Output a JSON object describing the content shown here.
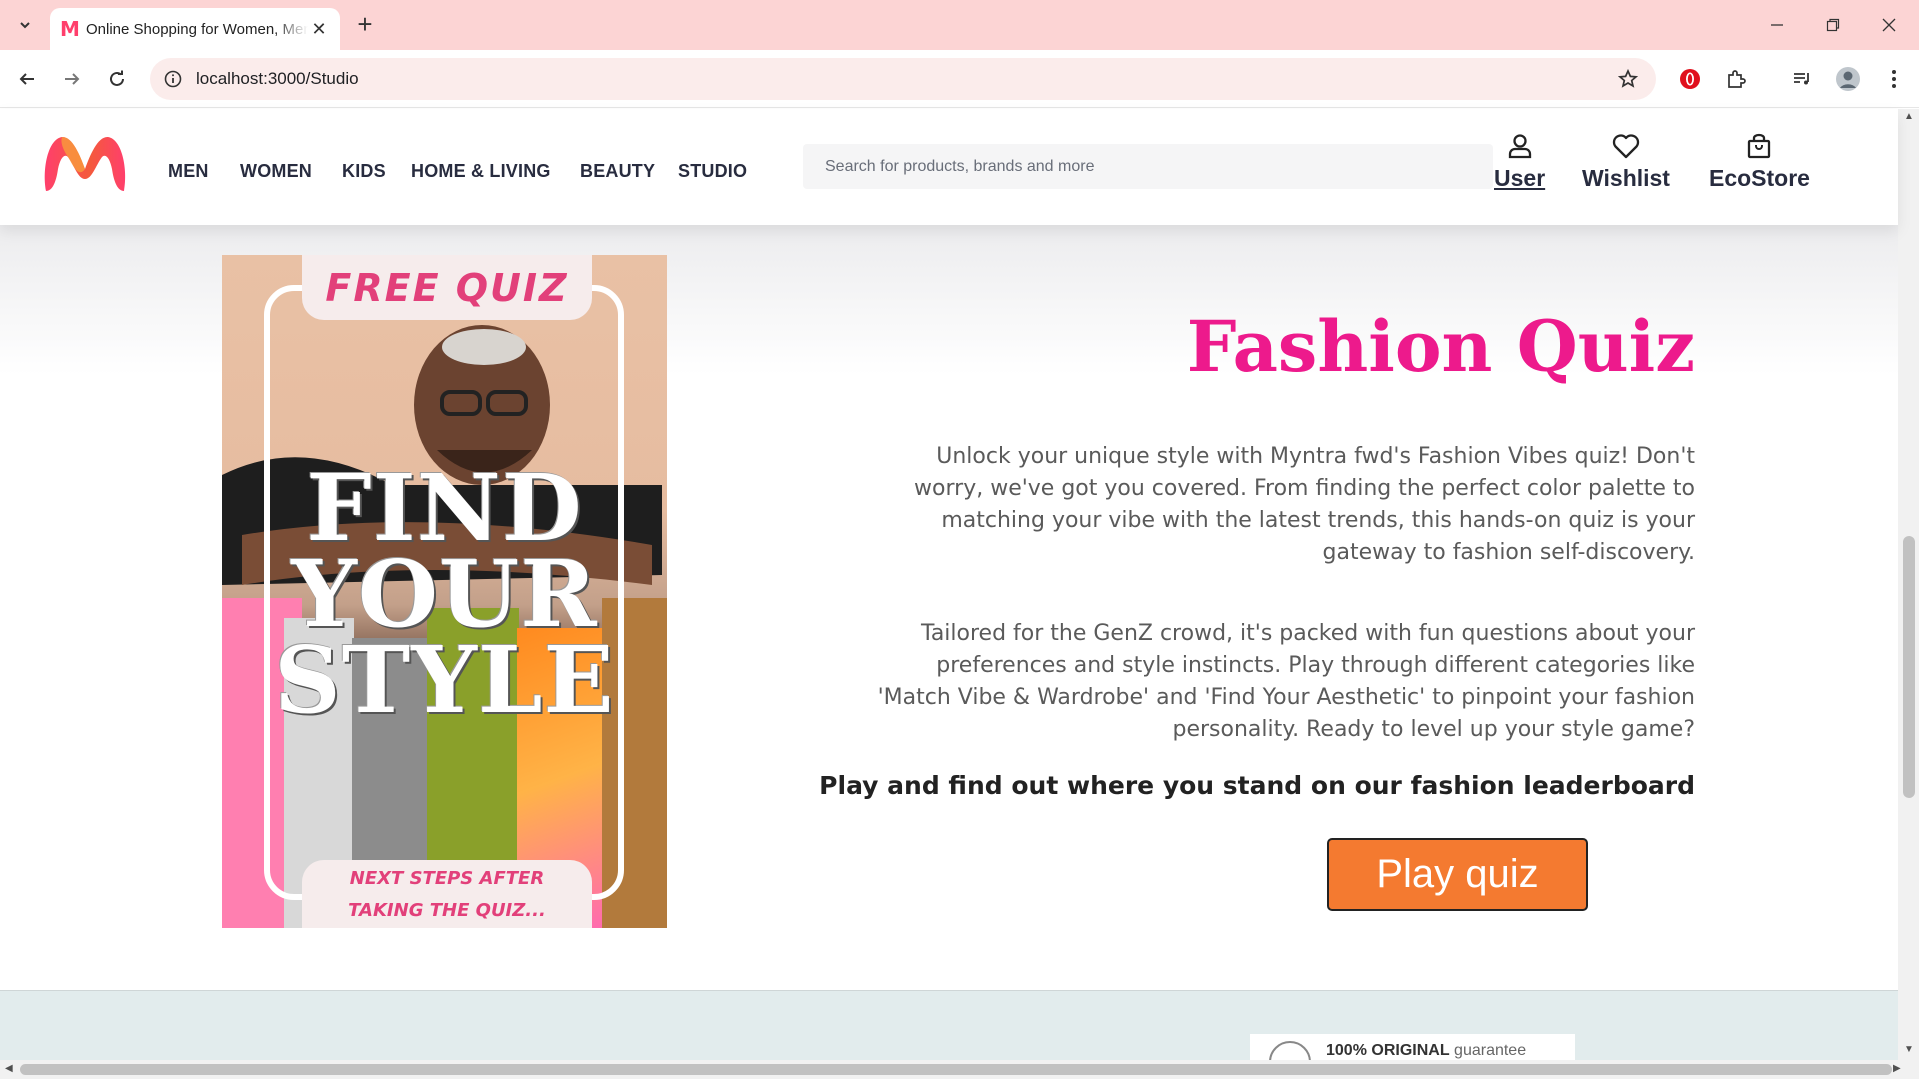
{
  "browser": {
    "tab_title": "Online Shopping for Women, Men",
    "tab_favicon": "M",
    "tab_close": "✕",
    "new_tab": "+",
    "url": "localhost:3000/Studio"
  },
  "nav": {
    "items": [
      {
        "label": "MEN"
      },
      {
        "label": "WOMEN"
      },
      {
        "label": "KIDS"
      },
      {
        "label": "HOME & LIVING"
      },
      {
        "label": "BEAUTY"
      },
      {
        "label": "STUDIO"
      }
    ]
  },
  "search": {
    "placeholder": "Search for products, brands and more"
  },
  "header_actions": {
    "user": "User",
    "wishlist": "Wishlist",
    "ecostore": "EcoStore"
  },
  "poster": {
    "badge_top": "FREE QUIZ",
    "headline_lines": [
      "FIND",
      "YOUR",
      "STYLE"
    ],
    "badge_bottom": "NEXT STEPS AFTER TAKING THE QUIZ..."
  },
  "quiz": {
    "title": "Fashion Quiz",
    "paragraph1": "Unlock your unique style with Myntra fwd's Fashion Vibes quiz! Don't worry, we've got you covered. From finding the perfect color palette to matching your vibe with the latest trends, this hands-on quiz is your gateway to fashion self-discovery.",
    "paragraph2": "Tailored for the GenZ crowd, it's packed with fun questions about your preferences and style instincts. Play through different categories like 'Match Vibe & Wardrobe' and 'Find Your Aesthetic' to pinpoint your fashion personality. Ready to level up your style game?",
    "leaderboard_text": "Play and find out where you stand on our fashion leaderboard",
    "play_button": "Play quiz"
  },
  "footer": {
    "badge_bold": "100% ORIGINAL",
    "badge_rest": " guarantee"
  },
  "colors": {
    "brand_pink": "#ed1a8c",
    "play_orange": "#f47a30",
    "tab_strip": "#fcd4d4"
  }
}
